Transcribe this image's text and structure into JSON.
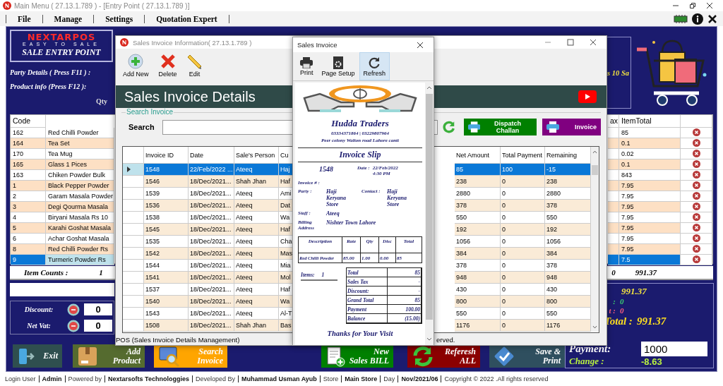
{
  "window": {
    "title": "Main Menu ( 27.13.1.789 ) - [Entry Point ( 27.13.1.789 )]",
    "menu": [
      "File",
      "Manage",
      "Settings",
      "Quotation Expert"
    ]
  },
  "brand": {
    "name": "NEXTARPOS",
    "tagline": "EASY TO SALE",
    "subtitle": "SALE ENTRY POINT"
  },
  "entry": {
    "party_label": "Party Details ( Press F11 ) :",
    "product_label": "Product info (Press F12 ):",
    "qty_label": "Qty",
    "banner": "s 10 Sa"
  },
  "cart": {
    "columns": [
      "Code",
      "ax",
      "ItemTotal"
    ],
    "rows": [
      {
        "code": "162",
        "name": "Red Chilli Powder",
        "item_total": "85",
        "selected": false
      },
      {
        "code": "164",
        "name": "Tea Set",
        "item_total": "0.1",
        "selected": false
      },
      {
        "code": "170",
        "name": "Tea Mug",
        "item_total": "0.02",
        "selected": false
      },
      {
        "code": "165",
        "name": "Glass 1 Pices",
        "item_total": "0.1",
        "selected": false
      },
      {
        "code": "163",
        "name": "Chiken Powder Bulk",
        "item_total": "843",
        "selected": false
      },
      {
        "code": "1",
        "name": "Black Pepper Powder",
        "item_total": "7.95",
        "selected": false
      },
      {
        "code": "2",
        "name": "Garam Masala Powder",
        "item_total": "7.95",
        "selected": false
      },
      {
        "code": "3",
        "name": "Degi Qourma Masala",
        "item_total": "7.95",
        "selected": false
      },
      {
        "code": "4",
        "name": "Biryani Masala  Rs 10",
        "item_total": "7.95",
        "selected": false
      },
      {
        "code": "5",
        "name": "Karahi Goshat Masala",
        "item_total": "7.95",
        "selected": false
      },
      {
        "code": "6",
        "name": "Achar Goshat Masala",
        "item_total": "7.95",
        "selected": false
      },
      {
        "code": "8",
        "name": "Red Chilli Powder Rs",
        "item_total": "7.95",
        "selected": false
      },
      {
        "code": "9",
        "name": "Turmeric Powder Rs",
        "item_total": "7.5",
        "selected": true
      }
    ],
    "item_counts_label": "Item Counts :",
    "item_counts": "1",
    "tax_total": "0",
    "grand_total": "991.37"
  },
  "adjustments": [
    {
      "label": "Discount:",
      "value": "0"
    },
    {
      "label": "Net Vat:",
      "value": "0"
    }
  ],
  "summary": [
    {
      "kind": "subtotal",
      "value": "991.37"
    },
    {
      "kind": "vat",
      "label": ":",
      "value": "0"
    },
    {
      "kind": "discount",
      "label": "t :",
      "value": "0"
    },
    {
      "kind": "total",
      "label": "Total :",
      "value": "991.37"
    }
  ],
  "payment": {
    "label": "Payment:",
    "value": "1000"
  },
  "change": {
    "label": "Change :",
    "value": "-8.63"
  },
  "actions": [
    {
      "kind": "exit",
      "lines": [
        "Exit"
      ]
    },
    {
      "kind": "add",
      "lines": [
        "Add",
        "Product"
      ]
    },
    {
      "kind": "search",
      "lines": [
        "Search",
        "Invoice"
      ]
    },
    {
      "kind": "new",
      "lines": [
        "New",
        "Sales BILL"
      ]
    },
    {
      "kind": "refresh",
      "lines": [
        "Referesh",
        "ALL"
      ]
    },
    {
      "kind": "save",
      "lines": [
        "Save &",
        "Print"
      ]
    }
  ],
  "status_bar": [
    {
      "text": "Login User",
      "bold": false
    },
    {
      "text": "Admin",
      "bold": true
    },
    {
      "text": "Powered by",
      "bold": false
    },
    {
      "text": "Nextarsofts Technologgies",
      "bold": true
    },
    {
      "text": "Developed By",
      "bold": false
    },
    {
      "text": "Muhammad Usman Ayub",
      "bold": true
    },
    {
      "text": "Store",
      "bold": false
    },
    {
      "text": "Main Store",
      "bold": true
    },
    {
      "text": "Day",
      "bold": false
    },
    {
      "text": "Nov/2021/06",
      "bold": true
    },
    {
      "text": "Copyright © 2022  .All rights reserved",
      "bold": false
    }
  ],
  "invoice_list_window": {
    "title": "Sales Invoice Information( 27.13.1.789 )",
    "tools": [
      {
        "kind": "add",
        "label": "Add New"
      },
      {
        "kind": "delete",
        "label": "Delete"
      },
      {
        "kind": "edit",
        "label": "Edit"
      }
    ],
    "heading": "Sales Invoice Details",
    "search_group": "Search Invoice",
    "search_label": "Search",
    "buttons": [
      {
        "kind": "challan",
        "label": "Dispatch Challan"
      },
      {
        "kind": "invoice",
        "label": "Invoice"
      }
    ],
    "columns": [
      "Invoice ID",
      "Date",
      "Sale's Person",
      "Cu",
      "Net Amount",
      "Total Payment",
      "Remaining"
    ],
    "rows": [
      {
        "id": "1548",
        "date": "22/Feb/2022 ...",
        "person": "Ateeq",
        "customer": "Haj",
        "net": "85",
        "paid": "100",
        "remaining": "-15",
        "selected": true
      },
      {
        "id": "1546",
        "date": "18/Dec/2021...",
        "person": "Shah Jhan",
        "customer": "Haf",
        "net": "238",
        "paid": "0",
        "remaining": "238",
        "selected": false
      },
      {
        "id": "1539",
        "date": "18/Dec/2021...",
        "person": "Ateeq",
        "customer": "Ami",
        "net": "2880",
        "paid": "0",
        "remaining": "2880",
        "selected": false
      },
      {
        "id": "1536",
        "date": "18/Dec/2021...",
        "person": "Ateeq",
        "customer": "Dat",
        "net": "378",
        "paid": "0",
        "remaining": "378",
        "selected": false
      },
      {
        "id": "1538",
        "date": "18/Dec/2021...",
        "person": "Ateeq",
        "customer": "Wa",
        "net": "550",
        "paid": "0",
        "remaining": "550",
        "selected": false
      },
      {
        "id": "1545",
        "date": "18/Dec/2021...",
        "person": "Ateeq",
        "customer": "Haf",
        "net": "192",
        "paid": "0",
        "remaining": "192",
        "selected": false
      },
      {
        "id": "1535",
        "date": "18/Dec/2021...",
        "person": "Ateeq",
        "customer": "Cha",
        "net": "1056",
        "paid": "0",
        "remaining": "1056",
        "selected": false
      },
      {
        "id": "1542",
        "date": "18/Dec/2021...",
        "person": "Ateeq",
        "customer": "Mas",
        "net": "384",
        "paid": "0",
        "remaining": "384",
        "selected": false
      },
      {
        "id": "1544",
        "date": "18/Dec/2021...",
        "person": "Ateeq",
        "customer": "Mia",
        "net": "378",
        "paid": "0",
        "remaining": "378",
        "selected": false
      },
      {
        "id": "1541",
        "date": "18/Dec/2021...",
        "person": "Ateeq",
        "customer": "Mol",
        "net": "948",
        "paid": "0",
        "remaining": "948",
        "selected": false
      },
      {
        "id": "1537",
        "date": "18/Dec/2021...",
        "person": "Ateeq",
        "customer": "Haf",
        "net": "430",
        "paid": "0",
        "remaining": "430",
        "selected": false
      },
      {
        "id": "1540",
        "date": "18/Dec/2021...",
        "person": "Ateeq",
        "customer": "Wa",
        "net": "800",
        "paid": "0",
        "remaining": "800",
        "selected": false
      },
      {
        "id": "1543",
        "date": "18/Dec/2021...",
        "person": "Ateeq",
        "customer": "Al-T",
        "net": "550",
        "paid": "0",
        "remaining": "550",
        "selected": false
      },
      {
        "id": "1508",
        "date": "18/Dec/2021...",
        "person": "Shah Jhan",
        "customer": "Bas",
        "net": "1176",
        "paid": "0",
        "remaining": "1176",
        "selected": false
      }
    ],
    "status": "POS (Sales Invoice Details Management)",
    "status_tail": "erved."
  },
  "invoice_window": {
    "title": "Sales Invoice",
    "tools": [
      {
        "kind": "print",
        "label": "Print",
        "selected": false
      },
      {
        "kind": "setup",
        "label": "Page Setup",
        "selected": false
      },
      {
        "kind": "refresh",
        "label": "Refresh",
        "selected": true
      }
    ],
    "slip": {
      "shop": "Hudda Traders",
      "phones": "03334371864 | 03229807964",
      "address": "Peer colony Walton road Lahore cantt",
      "heading": "Invoice Slip",
      "number": "1548",
      "date_label": "Date :",
      "date": "22/Feb/2022 4:30 PM",
      "invoice_label": "Invoice # :",
      "party_label": "Party :",
      "party": "Haji Keryana Store",
      "contact_label": "Contact :",
      "contact": "Haji Keryana Store",
      "staff_label": "Staff :",
      "staff": "Ateeq",
      "billing_label": "Billing Address",
      "billing": "Nishter Town Lahore",
      "item_columns": [
        "Description",
        "Rate",
        "Qty",
        "Disc",
        "Total"
      ],
      "items": [
        {
          "description": "Red Chilli Powder",
          "rate": "85.00",
          "qty": "1.00",
          "disc": "0.00",
          "total": "85"
        }
      ],
      "items_label": "Items:",
      "items_count": "1",
      "summary": [
        {
          "label": "Total",
          "value": "85"
        },
        {
          "label": "Sales Tax",
          "value": "-"
        },
        {
          "label": "Discount:",
          "value": "-"
        },
        {
          "label": "Grand Total",
          "value": "85"
        },
        {
          "label": "Payment",
          "value": "100.00"
        },
        {
          "label": "Balance",
          "value": "(15.00)"
        }
      ],
      "footer": "Thanks for Your Visit"
    }
  }
}
